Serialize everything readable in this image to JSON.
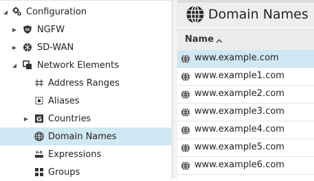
{
  "tree": {
    "root_label": "Configuration",
    "items": [
      {
        "label": "NGFW"
      },
      {
        "label": "SD-WAN"
      },
      {
        "label": "Network Elements"
      },
      {
        "label": "Address Ranges"
      },
      {
        "label": "Aliases"
      },
      {
        "label": "Countries"
      },
      {
        "label": "Domain Names"
      },
      {
        "label": "Expressions"
      },
      {
        "label": "Groups"
      }
    ]
  },
  "panel": {
    "title": "Domain Names",
    "column_name": "Name",
    "rows": [
      "www.example.com",
      "www.example1.com",
      "www.example2.com",
      "www.example3.com",
      "www.example4.com",
      "www.example5.com",
      "www.example6.com"
    ]
  },
  "colors": {
    "selection": "#cfe8f3",
    "header_bg": "#eeeeee"
  },
  "icons": {
    "root": "gears-icon",
    "ngfw": "shield-icon",
    "sdwan": "network-globe-icon",
    "network_elements": "stacked-squares-icon",
    "address_ranges": "hash-range-icon",
    "aliases": "alias-box-icon",
    "countries": "country-g-icon",
    "domain_names": "globe-icon",
    "expressions": "expression-ab-icon",
    "groups": "grid-icon"
  }
}
